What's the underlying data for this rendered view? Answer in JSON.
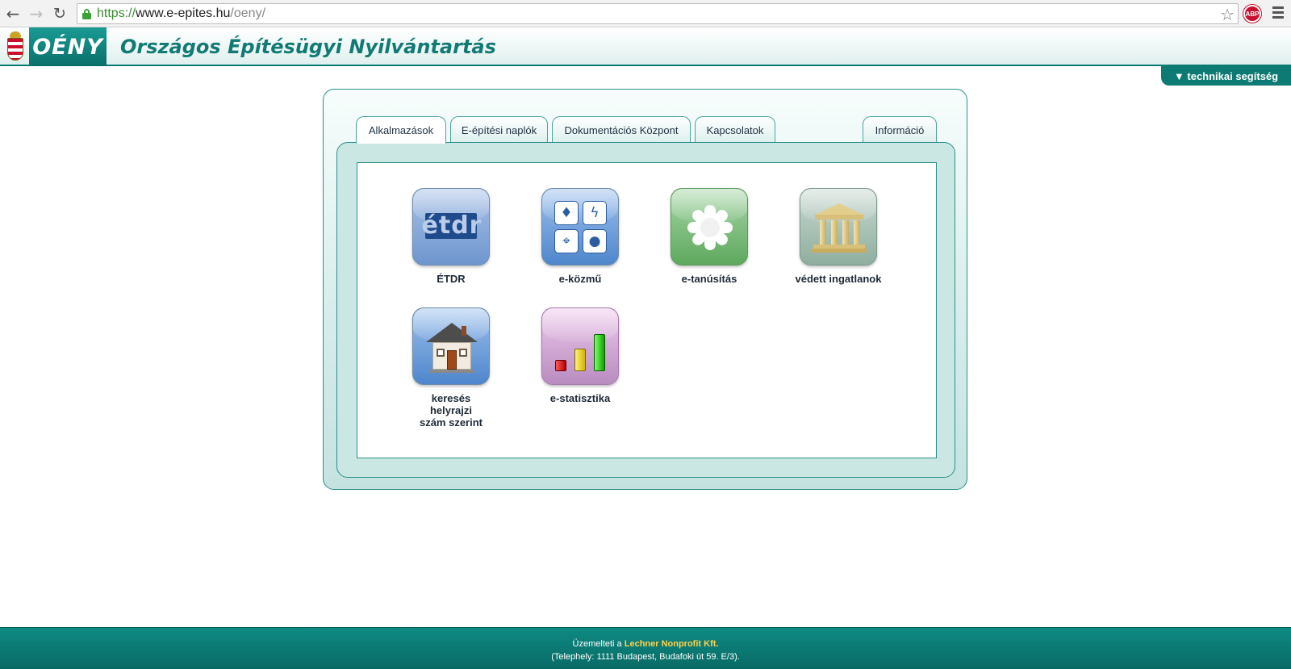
{
  "browser": {
    "url_scheme": "https://",
    "url_host": "www.e-epites.hu",
    "url_path": "/oeny/",
    "adblock_label": "ABP"
  },
  "header": {
    "logo": "OÉNY",
    "title": "Országos Építésügyi Nyilvántartás",
    "help_tab": "▼ technikai segítség"
  },
  "tabs": [
    {
      "label": "Alkalmazások",
      "active": true
    },
    {
      "label": "E-építési naplók",
      "active": false
    },
    {
      "label": "Dokumentációs Központ",
      "active": false
    },
    {
      "label": "Kapcsolatok",
      "active": false
    },
    {
      "label": "Információ",
      "active": false
    }
  ],
  "apps": [
    {
      "label": "ÉTDR",
      "icon": "etdr-logo-icon",
      "icon_text": "étdr"
    },
    {
      "label": "e-közmű",
      "icon": "utilities-icon"
    },
    {
      "label": "e-tanúsítás",
      "icon": "flower-icon"
    },
    {
      "label": "védett ingatlanok",
      "icon": "temple-icon"
    },
    {
      "label": "keresés helyrajzi szám szerint",
      "icon": "house-icon"
    },
    {
      "label": "e-statisztika",
      "icon": "bar-chart-icon"
    }
  ],
  "footer": {
    "operated_by": "Üzemelteti a",
    "company": "Lechner Nonprofit Kft.",
    "address": "(Telephely: 1111 Budapest, Budafoki út 59. E/3)."
  },
  "colors": {
    "brand_teal": "#0d7a73",
    "title_teal": "#127a74",
    "footer_highlight": "#ffd24a"
  }
}
